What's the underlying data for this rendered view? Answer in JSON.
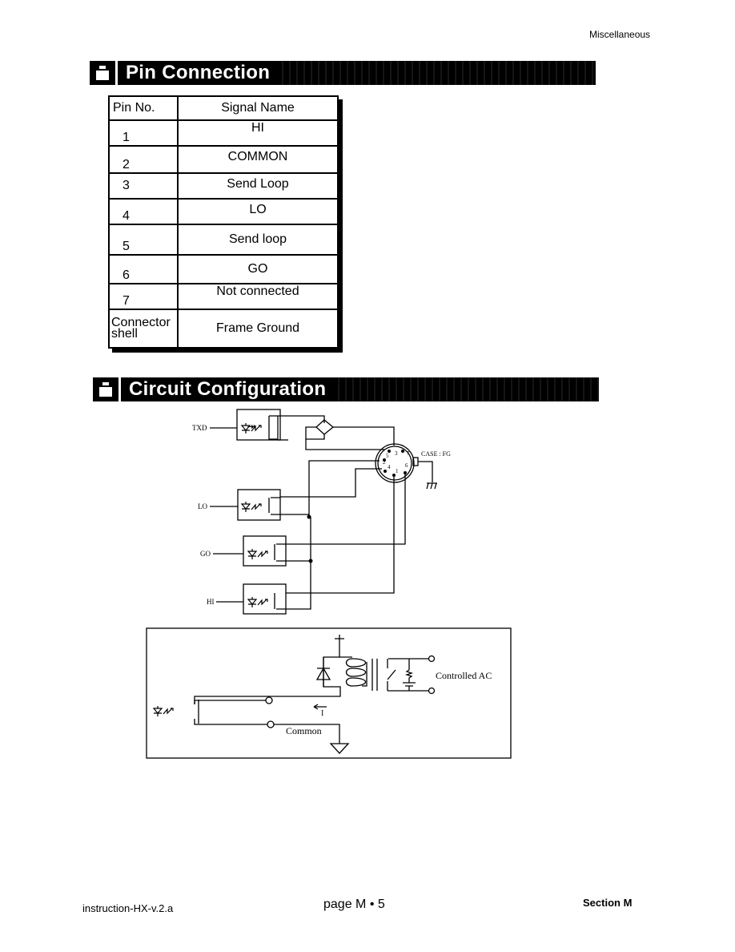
{
  "header": {
    "section_label": "Miscellaneous"
  },
  "pin_connection": {
    "title": "Pin Connection",
    "icon": "weight-icon",
    "columns": [
      "Pin No.",
      "Signal Name"
    ],
    "rows": [
      {
        "pin": "1",
        "signal": "HI"
      },
      {
        "pin": "2",
        "signal": "COMMON"
      },
      {
        "pin": "3",
        "signal": "Send Loop"
      },
      {
        "pin": "4",
        "signal": "LO"
      },
      {
        "pin": "5",
        "signal": "Send loop"
      },
      {
        "pin": "6",
        "signal": "GO"
      },
      {
        "pin": "7",
        "signal": "Not connected"
      },
      {
        "pin": "Connector shell",
        "signal": "Frame Ground"
      }
    ]
  },
  "circuit_configuration": {
    "title": "Circuit Configuration",
    "icon": "weight-icon",
    "diagram": {
      "inputs": [
        "TXD",
        "LO",
        "GO",
        "HI"
      ],
      "connector_pins": [
        "1",
        "2",
        "3",
        "4",
        "5",
        "6",
        "7"
      ],
      "case_label": "CASE : FG"
    },
    "relay_example": {
      "plus_label": "+",
      "current_label": "I",
      "common_label": "Common",
      "controlled_label": "Controlled AC"
    }
  },
  "footer": {
    "doc_id": "instruction-HX-v.2.a",
    "page": "page M • 5",
    "section": "Section M"
  }
}
